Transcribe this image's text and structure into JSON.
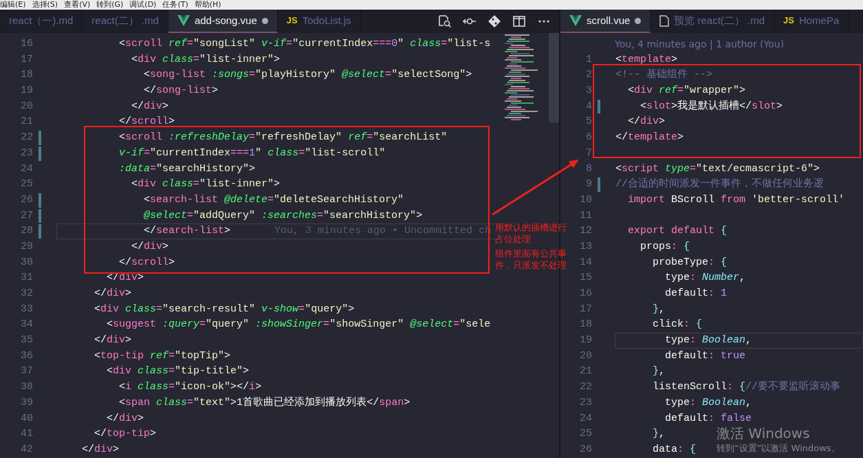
{
  "menu": [
    "编辑(E)",
    "选择(S)",
    "查看(V)",
    "转到(G)",
    "调试(D)",
    "任务(T)",
    "帮助(H)"
  ],
  "left_editor": {
    "tabs": [
      {
        "label": "react（一).md",
        "kind": "markdown",
        "selected": false,
        "modified": false
      },
      {
        "label": "react(二） .md",
        "kind": "markdown",
        "selected": false,
        "modified": false
      },
      {
        "label": "add-song.vue",
        "kind": "vue",
        "selected": true,
        "modified": true
      },
      {
        "label": "TodoList.js",
        "kind": "js",
        "icon_text": "JS",
        "selected": false,
        "modified": false
      }
    ],
    "lines": [
      {
        "n": "16",
        "changed": false,
        "current": false,
        "code": [
          {
            "kind": "punct",
            "text": "          <"
          },
          {
            "kind": "tag",
            "text": "scroll"
          },
          {
            "kind": "attr",
            "text": " ref"
          },
          {
            "kind": "op",
            "text": "="
          },
          {
            "kind": "string",
            "text": "\"songList\""
          },
          {
            "kind": "attr",
            "text": " v-if"
          },
          {
            "kind": "op",
            "text": "="
          },
          {
            "kind": "string",
            "text": "\"currentIndex"
          },
          {
            "kind": "op",
            "text": "==="
          },
          {
            "kind": "number",
            "text": "0"
          },
          {
            "kind": "string",
            "text": "\""
          },
          {
            "kind": "attr",
            "text": " class"
          },
          {
            "kind": "op",
            "text": "="
          },
          {
            "kind": "string",
            "text": "\"list-s"
          }
        ]
      },
      {
        "n": "17",
        "changed": false,
        "current": false,
        "code": [
          {
            "kind": "punct",
            "text": "            <"
          },
          {
            "kind": "tag",
            "text": "div"
          },
          {
            "kind": "attr",
            "text": " class"
          },
          {
            "kind": "op",
            "text": "="
          },
          {
            "kind": "string",
            "text": "\"list-inner\""
          },
          {
            "kind": "punct",
            "text": ">"
          }
        ]
      },
      {
        "n": "18",
        "changed": false,
        "current": false,
        "code": [
          {
            "kind": "punct",
            "text": "              <"
          },
          {
            "kind": "tag",
            "text": "song-list"
          },
          {
            "kind": "attr",
            "text": " :songs"
          },
          {
            "kind": "op",
            "text": "="
          },
          {
            "kind": "string",
            "text": "\"playHistory\""
          },
          {
            "kind": "attr",
            "text": " @select"
          },
          {
            "kind": "op",
            "text": "="
          },
          {
            "kind": "string",
            "text": "\"selectSong\""
          },
          {
            "kind": "punct",
            "text": ">"
          }
        ]
      },
      {
        "n": "19",
        "changed": false,
        "current": false,
        "code": [
          {
            "kind": "punct",
            "text": "              </"
          },
          {
            "kind": "tag",
            "text": "song-list"
          },
          {
            "kind": "punct",
            "text": ">"
          }
        ]
      },
      {
        "n": "20",
        "changed": false,
        "current": false,
        "code": [
          {
            "kind": "punct",
            "text": "            </"
          },
          {
            "kind": "tag",
            "text": "div"
          },
          {
            "kind": "punct",
            "text": ">"
          }
        ]
      },
      {
        "n": "21",
        "changed": false,
        "current": false,
        "code": [
          {
            "kind": "punct",
            "text": "          </"
          },
          {
            "kind": "tag",
            "text": "scroll"
          },
          {
            "kind": "punct",
            "text": ">"
          }
        ]
      },
      {
        "n": "22",
        "changed": true,
        "current": false,
        "code": [
          {
            "kind": "punct",
            "text": "          <"
          },
          {
            "kind": "tag",
            "text": "scroll"
          },
          {
            "kind": "attr",
            "text": " :refreshDelay"
          },
          {
            "kind": "op",
            "text": "="
          },
          {
            "kind": "string",
            "text": "\"refreshDelay\""
          },
          {
            "kind": "attr",
            "text": " ref"
          },
          {
            "kind": "op",
            "text": "="
          },
          {
            "kind": "string",
            "text": "\"searchList\""
          }
        ]
      },
      {
        "n": "23",
        "changed": true,
        "current": false,
        "code": [
          {
            "kind": "attr",
            "text": "          v-if"
          },
          {
            "kind": "op",
            "text": "="
          },
          {
            "kind": "string",
            "text": "\"currentIndex"
          },
          {
            "kind": "op",
            "text": "==="
          },
          {
            "kind": "number",
            "text": "1"
          },
          {
            "kind": "string",
            "text": "\""
          },
          {
            "kind": "attr",
            "text": " class"
          },
          {
            "kind": "op",
            "text": "="
          },
          {
            "kind": "string",
            "text": "\"list-scroll\""
          }
        ]
      },
      {
        "n": "24",
        "changed": false,
        "current": false,
        "code": [
          {
            "kind": "attr",
            "text": "          :data"
          },
          {
            "kind": "op",
            "text": "="
          },
          {
            "kind": "string",
            "text": "\"searchHistory\""
          },
          {
            "kind": "punct",
            "text": ">"
          }
        ]
      },
      {
        "n": "25",
        "changed": false,
        "current": false,
        "code": [
          {
            "kind": "punct",
            "text": "            <"
          },
          {
            "kind": "tag",
            "text": "div"
          },
          {
            "kind": "attr",
            "text": " class"
          },
          {
            "kind": "op",
            "text": "="
          },
          {
            "kind": "string",
            "text": "\"list-inner\""
          },
          {
            "kind": "punct",
            "text": ">"
          }
        ]
      },
      {
        "n": "26",
        "changed": true,
        "current": false,
        "code": [
          {
            "kind": "punct",
            "text": "              <"
          },
          {
            "kind": "tag",
            "text": "search-list"
          },
          {
            "kind": "attr",
            "text": " @delete"
          },
          {
            "kind": "op",
            "text": "="
          },
          {
            "kind": "string",
            "text": "\"deleteSearchHistory\""
          }
        ]
      },
      {
        "n": "27",
        "changed": true,
        "current": false,
        "code": [
          {
            "kind": "attr",
            "text": "              @select"
          },
          {
            "kind": "op",
            "text": "="
          },
          {
            "kind": "string",
            "text": "\"addQuery\""
          },
          {
            "kind": "attr",
            "text": " :searches"
          },
          {
            "kind": "op",
            "text": "="
          },
          {
            "kind": "string",
            "text": "\"searchHistory\""
          },
          {
            "kind": "punct",
            "text": ">"
          }
        ]
      },
      {
        "n": "28",
        "changed": true,
        "current": true,
        "code": [
          {
            "kind": "punct",
            "text": "              </"
          },
          {
            "kind": "tag",
            "text": "search-list"
          },
          {
            "kind": "punct",
            "text": ">"
          }
        ],
        "blame": "You, 3 minutes ago • Uncommitted ch"
      },
      {
        "n": "29",
        "changed": false,
        "current": false,
        "code": [
          {
            "kind": "punct",
            "text": "            </"
          },
          {
            "kind": "tag",
            "text": "div"
          },
          {
            "kind": "punct",
            "text": ">"
          }
        ]
      },
      {
        "n": "30",
        "changed": false,
        "current": false,
        "code": [
          {
            "kind": "punct",
            "text": "          </"
          },
          {
            "kind": "tag",
            "text": "scroll"
          },
          {
            "kind": "punct",
            "text": ">"
          }
        ]
      },
      {
        "n": "31",
        "changed": false,
        "current": false,
        "code": [
          {
            "kind": "punct",
            "text": "        </"
          },
          {
            "kind": "tag",
            "text": "div"
          },
          {
            "kind": "punct",
            "text": ">"
          }
        ]
      },
      {
        "n": "32",
        "changed": false,
        "current": false,
        "code": [
          {
            "kind": "punct",
            "text": "      </"
          },
          {
            "kind": "tag",
            "text": "div"
          },
          {
            "kind": "punct",
            "text": ">"
          }
        ]
      },
      {
        "n": "33",
        "changed": false,
        "current": false,
        "code": [
          {
            "kind": "punct",
            "text": "      <"
          },
          {
            "kind": "tag",
            "text": "div"
          },
          {
            "kind": "attr",
            "text": " class"
          },
          {
            "kind": "op",
            "text": "="
          },
          {
            "kind": "string",
            "text": "\"search-result\""
          },
          {
            "kind": "attr",
            "text": " v-show"
          },
          {
            "kind": "op",
            "text": "="
          },
          {
            "kind": "string",
            "text": "\"query\""
          },
          {
            "kind": "punct",
            "text": ">"
          }
        ]
      },
      {
        "n": "34",
        "changed": false,
        "current": false,
        "code": [
          {
            "kind": "punct",
            "text": "        <"
          },
          {
            "kind": "tag",
            "text": "suggest"
          },
          {
            "kind": "attr",
            "text": " :query"
          },
          {
            "kind": "op",
            "text": "="
          },
          {
            "kind": "string",
            "text": "\"query\""
          },
          {
            "kind": "attr",
            "text": " :showSinger"
          },
          {
            "kind": "op",
            "text": "="
          },
          {
            "kind": "string",
            "text": "\"showSinger\""
          },
          {
            "kind": "attr",
            "text": " @select"
          },
          {
            "kind": "op",
            "text": "="
          },
          {
            "kind": "string",
            "text": "\"sele"
          }
        ]
      },
      {
        "n": "35",
        "changed": false,
        "current": false,
        "code": [
          {
            "kind": "punct",
            "text": "      </"
          },
          {
            "kind": "tag",
            "text": "div"
          },
          {
            "kind": "punct",
            "text": ">"
          }
        ]
      },
      {
        "n": "36",
        "changed": false,
        "current": false,
        "code": [
          {
            "kind": "punct",
            "text": "      <"
          },
          {
            "kind": "tag",
            "text": "top-tip"
          },
          {
            "kind": "attr",
            "text": " ref"
          },
          {
            "kind": "op",
            "text": "="
          },
          {
            "kind": "string",
            "text": "\"topTip\""
          },
          {
            "kind": "punct",
            "text": ">"
          }
        ]
      },
      {
        "n": "37",
        "changed": false,
        "current": false,
        "code": [
          {
            "kind": "punct",
            "text": "        <"
          },
          {
            "kind": "tag",
            "text": "div"
          },
          {
            "kind": "attr",
            "text": " class"
          },
          {
            "kind": "op",
            "text": "="
          },
          {
            "kind": "string",
            "text": "\"tip-title\""
          },
          {
            "kind": "punct",
            "text": ">"
          }
        ]
      },
      {
        "n": "38",
        "changed": false,
        "current": false,
        "code": [
          {
            "kind": "punct",
            "text": "          <"
          },
          {
            "kind": "tag",
            "text": "i"
          },
          {
            "kind": "attr",
            "text": " class"
          },
          {
            "kind": "op",
            "text": "="
          },
          {
            "kind": "string",
            "text": "\"icon-ok\""
          },
          {
            "kind": "punct",
            "text": "></"
          },
          {
            "kind": "tag",
            "text": "i"
          },
          {
            "kind": "punct",
            "text": ">"
          }
        ]
      },
      {
        "n": "39",
        "changed": false,
        "current": false,
        "code": [
          {
            "kind": "punct",
            "text": "          <"
          },
          {
            "kind": "tag",
            "text": "span"
          },
          {
            "kind": "attr",
            "text": " class"
          },
          {
            "kind": "op",
            "text": "="
          },
          {
            "kind": "string",
            "text": "\"text\""
          },
          {
            "kind": "punct",
            "text": ">"
          },
          {
            "kind": "plain",
            "text": "1首歌曲已经添加到播放列表"
          },
          {
            "kind": "punct",
            "text": "</"
          },
          {
            "kind": "tag",
            "text": "span"
          },
          {
            "kind": "punct",
            "text": ">"
          }
        ]
      },
      {
        "n": "40",
        "changed": false,
        "current": false,
        "code": [
          {
            "kind": "punct",
            "text": "        </"
          },
          {
            "kind": "tag",
            "text": "div"
          },
          {
            "kind": "punct",
            "text": ">"
          }
        ]
      },
      {
        "n": "41",
        "changed": false,
        "current": false,
        "code": [
          {
            "kind": "punct",
            "text": "      </"
          },
          {
            "kind": "tag",
            "text": "top-tip"
          },
          {
            "kind": "punct",
            "text": ">"
          }
        ]
      },
      {
        "n": "42",
        "changed": false,
        "current": false,
        "code": [
          {
            "kind": "punct",
            "text": "    </"
          },
          {
            "kind": "tag",
            "text": "div"
          },
          {
            "kind": "punct",
            "text": ">"
          }
        ]
      }
    ]
  },
  "right_editor": {
    "tabs": [
      {
        "label": "scroll.vue",
        "kind": "vue",
        "selected": true,
        "modified": true
      },
      {
        "label": "预览 react(二） .md",
        "kind": "file",
        "selected": false,
        "modified": false
      },
      {
        "label": "HomePa",
        "kind": "js",
        "icon_text": "JS",
        "selected": false,
        "modified": false
      }
    ],
    "codelens": "You, 4 minutes ago | 1 author (You)",
    "lines": [
      {
        "n": "1",
        "changed": false,
        "current": false,
        "code": [
          {
            "kind": "punct",
            "text": "<"
          },
          {
            "kind": "tag",
            "text": "template"
          },
          {
            "kind": "punct",
            "text": ">"
          }
        ]
      },
      {
        "n": "2",
        "changed": false,
        "current": false,
        "code": [
          {
            "kind": "comment",
            "text": "<!-- 基础组件 -->"
          }
        ]
      },
      {
        "n": "3",
        "changed": false,
        "current": false,
        "code": [
          {
            "kind": "punct",
            "text": "  <"
          },
          {
            "kind": "tag",
            "text": "div"
          },
          {
            "kind": "attr",
            "text": " ref"
          },
          {
            "kind": "op",
            "text": "="
          },
          {
            "kind": "string",
            "text": "\"wrapper\""
          },
          {
            "kind": "punct",
            "text": ">"
          }
        ]
      },
      {
        "n": "4",
        "changed": true,
        "current": false,
        "code": [
          {
            "kind": "punct",
            "text": "    <"
          },
          {
            "kind": "tag",
            "text": "slot"
          },
          {
            "kind": "punct",
            "text": ">"
          },
          {
            "kind": "plain",
            "text": "我是默认插槽"
          },
          {
            "kind": "punct",
            "text": "</"
          },
          {
            "kind": "tag",
            "text": "slot"
          },
          {
            "kind": "punct",
            "text": ">"
          }
        ]
      },
      {
        "n": "5",
        "changed": false,
        "current": false,
        "code": [
          {
            "kind": "punct",
            "text": "  </"
          },
          {
            "kind": "tag",
            "text": "div"
          },
          {
            "kind": "punct",
            "text": ">"
          }
        ]
      },
      {
        "n": "6",
        "changed": false,
        "current": false,
        "code": [
          {
            "kind": "punct",
            "text": "</"
          },
          {
            "kind": "tag",
            "text": "template"
          },
          {
            "kind": "punct",
            "text": ">"
          }
        ]
      },
      {
        "n": "7",
        "changed": false,
        "current": false
      },
      {
        "n": "8",
        "changed": false,
        "current": false,
        "code": [
          {
            "kind": "punct",
            "text": "<"
          },
          {
            "kind": "tag",
            "text": "script"
          },
          {
            "kind": "attr",
            "text": " type"
          },
          {
            "kind": "op",
            "text": "="
          },
          {
            "kind": "string",
            "text": "\"text/ecmascript-6\""
          },
          {
            "kind": "punct",
            "text": ">"
          }
        ]
      },
      {
        "n": "9",
        "changed": true,
        "current": false,
        "code": [
          {
            "kind": "comment",
            "text": "//合适的时间派发一件事件，不做任何业务逻"
          }
        ]
      },
      {
        "n": "10",
        "changed": false,
        "current": false,
        "code": [
          {
            "kind": "keyword",
            "text": "  import"
          },
          {
            "kind": "plain",
            "text": " BScroll "
          },
          {
            "kind": "keyword",
            "text": "from"
          },
          {
            "kind": "string",
            "text": " 'better-scroll'"
          }
        ]
      },
      {
        "n": "11",
        "changed": false,
        "current": false
      },
      {
        "n": "12",
        "changed": false,
        "current": false,
        "code": [
          {
            "kind": "keyword",
            "text": "  export"
          },
          {
            "kind": "keyword",
            "text": " default"
          },
          {
            "kind": "brace",
            "text": " {"
          }
        ]
      },
      {
        "n": "13",
        "changed": false,
        "current": false,
        "code": [
          {
            "kind": "plain",
            "text": "    props"
          },
          {
            "kind": "op",
            "text": ":"
          },
          {
            "kind": "brace",
            "text": " {"
          }
        ]
      },
      {
        "n": "14",
        "changed": false,
        "current": false,
        "code": [
          {
            "kind": "plain",
            "text": "      probeType"
          },
          {
            "kind": "op",
            "text": ":"
          },
          {
            "kind": "brace",
            "text": " {"
          }
        ]
      },
      {
        "n": "15",
        "changed": false,
        "current": false,
        "code": [
          {
            "kind": "plain",
            "text": "        type"
          },
          {
            "kind": "op",
            "text": ":"
          },
          {
            "kind": "type",
            "text": " Number"
          },
          {
            "kind": "plain",
            "text": ","
          }
        ]
      },
      {
        "n": "16",
        "changed": false,
        "current": false,
        "code": [
          {
            "kind": "plain",
            "text": "        default"
          },
          {
            "kind": "op",
            "text": ":"
          },
          {
            "kind": "number",
            "text": " 1"
          }
        ]
      },
      {
        "n": "17",
        "changed": false,
        "current": false,
        "code": [
          {
            "kind": "brace",
            "text": "      }"
          },
          {
            "kind": "plain",
            "text": ","
          }
        ]
      },
      {
        "n": "18",
        "changed": false,
        "current": false,
        "code": [
          {
            "kind": "plain",
            "text": "      click"
          },
          {
            "kind": "op",
            "text": ":"
          },
          {
            "kind": "brace",
            "text": " {"
          }
        ]
      },
      {
        "n": "19",
        "changed": false,
        "current": true,
        "code": [
          {
            "kind": "plain",
            "text": "        type"
          },
          {
            "kind": "op",
            "text": ":"
          },
          {
            "kind": "type",
            "text": " Boolean"
          },
          {
            "kind": "plain",
            "text": ","
          }
        ]
      },
      {
        "n": "20",
        "changed": false,
        "current": false,
        "code": [
          {
            "kind": "plain",
            "text": "        default"
          },
          {
            "kind": "op",
            "text": ":"
          },
          {
            "kind": "number",
            "text": " true"
          }
        ]
      },
      {
        "n": "21",
        "changed": false,
        "current": false,
        "code": [
          {
            "kind": "brace",
            "text": "      }"
          },
          {
            "kind": "plain",
            "text": ","
          }
        ]
      },
      {
        "n": "22",
        "changed": false,
        "current": false,
        "code": [
          {
            "kind": "plain",
            "text": "      listenScroll"
          },
          {
            "kind": "op",
            "text": ":"
          },
          {
            "kind": "brace",
            "text": " {"
          },
          {
            "kind": "comment",
            "text": "//要不要监听滚动事"
          }
        ]
      },
      {
        "n": "23",
        "changed": false,
        "current": false,
        "code": [
          {
            "kind": "plain",
            "text": "        type"
          },
          {
            "kind": "op",
            "text": ":"
          },
          {
            "kind": "type",
            "text": " Boolean"
          },
          {
            "kind": "plain",
            "text": ","
          }
        ]
      },
      {
        "n": "24",
        "changed": false,
        "current": false,
        "code": [
          {
            "kind": "plain",
            "text": "        default"
          },
          {
            "kind": "op",
            "text": ":"
          },
          {
            "kind": "number",
            "text": " false"
          }
        ]
      },
      {
        "n": "25",
        "changed": false,
        "current": false,
        "code": [
          {
            "kind": "brace",
            "text": "      }"
          },
          {
            "kind": "plain",
            "text": ","
          }
        ]
      },
      {
        "n": "26",
        "changed": false,
        "current": false,
        "code": [
          {
            "kind": "plain",
            "text": "      data"
          },
          {
            "kind": "op",
            "text": ":"
          },
          {
            "kind": "brace",
            "text": " {"
          }
        ]
      }
    ]
  },
  "annotation": {
    "notes": [
      "用默认的插槽进行占位处理",
      "组件里面有公共事件，只派发不处理"
    ]
  },
  "os_notice": {
    "title": "激活 Windows",
    "text": "转到“设置”以激活 Windows。"
  }
}
